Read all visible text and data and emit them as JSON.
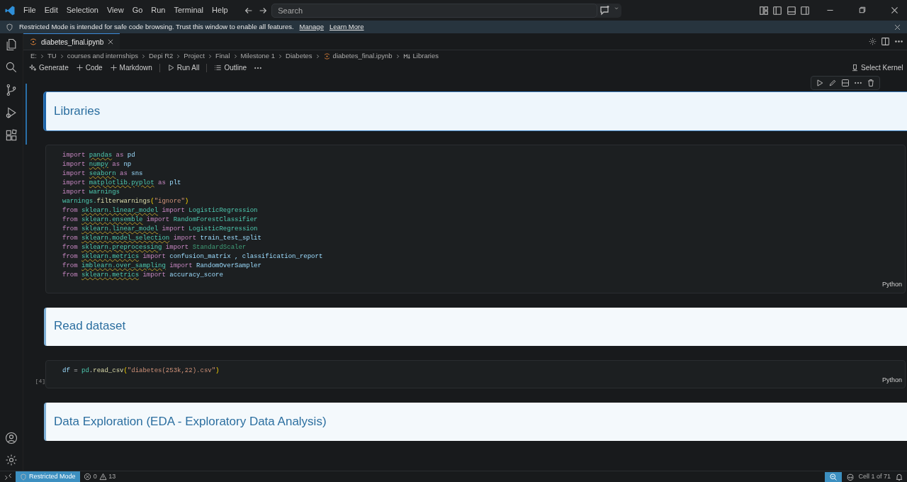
{
  "title_bar": {
    "menu": [
      "File",
      "Edit",
      "Selection",
      "View",
      "Go",
      "Run",
      "Terminal",
      "Help"
    ],
    "search": {
      "placeholder": "Search"
    }
  },
  "banner": {
    "message": "Restricted Mode is intended for safe code browsing. Trust this window to enable all features.",
    "links": [
      "Manage",
      "Learn More"
    ]
  },
  "tabs": [
    {
      "label": "diabetes_final.ipynb",
      "selected": true
    }
  ],
  "breadcrumb": [
    {
      "text": "E:",
      "kind": "folder"
    },
    {
      "text": "TU",
      "kind": "folder"
    },
    {
      "text": "courses and internships",
      "kind": "folder"
    },
    {
      "text": "Depi R2",
      "kind": "folder"
    },
    {
      "text": "Project",
      "kind": "folder"
    },
    {
      "text": "Final",
      "kind": "folder"
    },
    {
      "text": "Milestone 1",
      "kind": "folder"
    },
    {
      "text": "Diabetes",
      "kind": "folder"
    },
    {
      "text": "diabetes_final.ipynb",
      "kind": "notebook"
    },
    {
      "text": "Libraries",
      "kind": "markdown"
    }
  ],
  "toolbar": [
    {
      "label": "Generate",
      "kind": "sparkle"
    },
    {
      "label": "Code",
      "kind": "plus"
    },
    {
      "label": "Markdown",
      "kind": "plus"
    },
    {
      "label": "Run All",
      "kind": "run"
    },
    {
      "label": "Outline",
      "kind": "list"
    }
  ],
  "kernel": {
    "label": "Select Kernel"
  },
  "cells": [
    {
      "kind": "markdown",
      "heading": "Libraries",
      "selected": true
    },
    {
      "kind": "code",
      "selected": false,
      "language": "Python",
      "lines": [
        [
          {
            "text": "import ",
            "kind": "kw"
          },
          {
            "text": "pandas",
            "kind": "mod",
            "squiggle": true
          },
          {
            "text": " as ",
            "kind": "kw"
          },
          {
            "text": "pd",
            "kind": "var"
          }
        ],
        [
          {
            "text": "import ",
            "kind": "kw"
          },
          {
            "text": "numpy",
            "kind": "mod",
            "squiggle": true
          },
          {
            "text": " as ",
            "kind": "kw"
          },
          {
            "text": "np",
            "kind": "var"
          }
        ],
        [
          {
            "text": "import ",
            "kind": "kw"
          },
          {
            "text": "seaborn",
            "kind": "mod",
            "squiggle": true
          },
          {
            "text": " as ",
            "kind": "kw"
          },
          {
            "text": "sns",
            "kind": "var"
          }
        ],
        [
          {
            "text": "import ",
            "kind": "kw"
          },
          {
            "text": "matplotlib.pyplot",
            "kind": "mod",
            "squiggle": true
          },
          {
            "text": " as ",
            "kind": "kw"
          },
          {
            "text": "plt",
            "kind": "var"
          }
        ],
        [
          {
            "text": "import ",
            "kind": "kw"
          },
          {
            "text": "warnings",
            "kind": "mod"
          }
        ],
        [
          {
            "text": "warnings.",
            "kind": "mod"
          },
          {
            "text": "filterwarnings",
            "kind": "fn"
          },
          {
            "text": "(",
            "kind": "paren"
          },
          {
            "text": "\"ignore\"",
            "kind": "str"
          },
          {
            "text": ")",
            "kind": "paren"
          }
        ],
        [
          {
            "text": "from ",
            "kind": "kw"
          },
          {
            "text": "sklearn.linear_model",
            "kind": "mod",
            "squiggle": true
          },
          {
            "text": " import ",
            "kind": "kw"
          },
          {
            "text": "LogisticRegression",
            "kind": "cls"
          }
        ],
        [
          {
            "text": "from ",
            "kind": "kw"
          },
          {
            "text": "sklearn.ensemble",
            "kind": "mod",
            "squiggle": true
          },
          {
            "text": " import ",
            "kind": "kw"
          },
          {
            "text": "RandomForestClassifier",
            "kind": "cls"
          }
        ],
        [
          {
            "text": "from ",
            "kind": "kw"
          },
          {
            "text": "sklearn.linear_model",
            "kind": "mod",
            "squiggle": true
          },
          {
            "text": " import ",
            "kind": "kw"
          },
          {
            "text": "LogisticRegression",
            "kind": "cls"
          }
        ],
        [
          {
            "text": "from ",
            "kind": "kw"
          },
          {
            "text": "sklearn.model_selection",
            "kind": "mod",
            "squiggle": true
          },
          {
            "text": " import ",
            "kind": "kw"
          },
          {
            "text": "train_test_split",
            "kind": "var"
          }
        ],
        [
          {
            "text": "from ",
            "kind": "kw"
          },
          {
            "text": "sklearn.preprocessing",
            "kind": "mod",
            "squiggle": true
          },
          {
            "text": " import ",
            "kind": "kw"
          },
          {
            "text": "StandardScaler",
            "kind": "cls2"
          }
        ],
        [
          {
            "text": "from ",
            "kind": "kw"
          },
          {
            "text": "sklearn.metrics",
            "kind": "mod",
            "squiggle": true
          },
          {
            "text": " import ",
            "kind": "kw"
          },
          {
            "text": "confusion_matrix , classification_report",
            "kind": "var"
          }
        ],
        [
          {
            "text": "from ",
            "kind": "kw"
          },
          {
            "text": "imblearn.over_sampling",
            "kind": "mod",
            "squiggle": true
          },
          {
            "text": " import ",
            "kind": "kw"
          },
          {
            "text": "RandomOverSampler",
            "kind": "var"
          }
        ],
        [
          {
            "text": "from ",
            "kind": "kw"
          },
          {
            "text": "sklearn.metrics",
            "kind": "mod",
            "squiggle": true
          },
          {
            "text": " import ",
            "kind": "kw"
          },
          {
            "text": "accuracy_score",
            "kind": "var"
          }
        ]
      ]
    },
    {
      "kind": "markdown",
      "heading": "Read dataset",
      "selected": false
    },
    {
      "kind": "code",
      "selected": false,
      "language": "Python",
      "execution_count": "[4]",
      "lines": [
        [
          {
            "text": "df",
            "kind": "var"
          },
          {
            "text": " = ",
            "kind": "plain"
          },
          {
            "text": "pd",
            "kind": "mod"
          },
          {
            "text": ".",
            "kind": "plain"
          },
          {
            "text": "read_csv",
            "kind": "fn"
          },
          {
            "text": "(",
            "kind": "paren"
          },
          {
            "text": "\"diabetes(253k,22).csv\"",
            "kind": "str"
          },
          {
            "text": ")",
            "kind": "paren"
          }
        ]
      ]
    },
    {
      "kind": "markdown",
      "heading": "Data Exploration (EDA - Exploratory Data Analysis)",
      "selected": false
    }
  ],
  "status_bar": {
    "mode": "Restricted Mode",
    "errors": "0",
    "warnings": "13",
    "cell": "Cell 1 of 71"
  }
}
